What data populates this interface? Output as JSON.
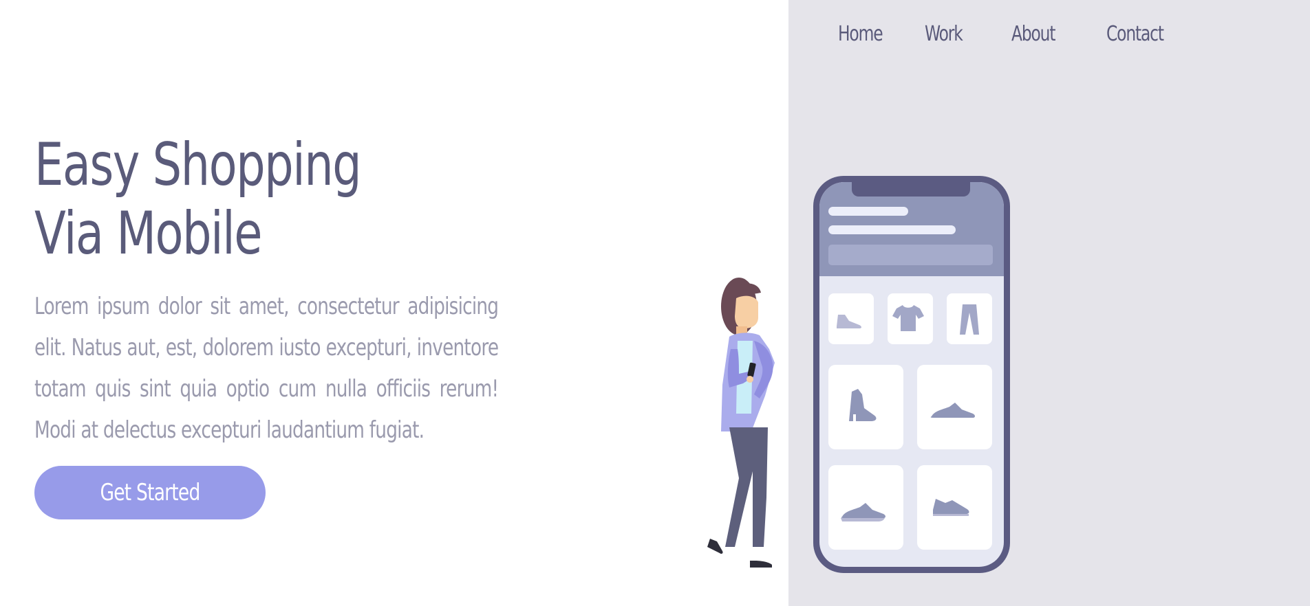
{
  "nav": {
    "items": [
      {
        "label": "Home"
      },
      {
        "label": "Work"
      },
      {
        "label": "About"
      },
      {
        "label": "Contact"
      }
    ]
  },
  "hero": {
    "title_line1": "Easy Shopping",
    "title_line2": "Via Mobile",
    "description": "Lorem ipsum dolor sit amet, consectetur adipisicing elit. Natus aut, est, dolorem iusto excepturi, inventore totam quis sint quia optio cum nulla officiis rerum! Modi at delectus excepturi laudantium fugiat.",
    "cta_label": "Get Started"
  },
  "illustration": {
    "phone_categories": [
      "shoe-icon",
      "tshirt-icon",
      "pants-icon"
    ],
    "phone_products": [
      "boot-icon",
      "sneaker-icon",
      "sneaker-icon",
      "sneaker-icon"
    ]
  },
  "colors": {
    "primary_text": "#5a5b7a",
    "muted_text": "#9a9aad",
    "accent": "#979be9",
    "panel_bg": "#e5e4ea",
    "phone_frame": "#5b5b82"
  }
}
